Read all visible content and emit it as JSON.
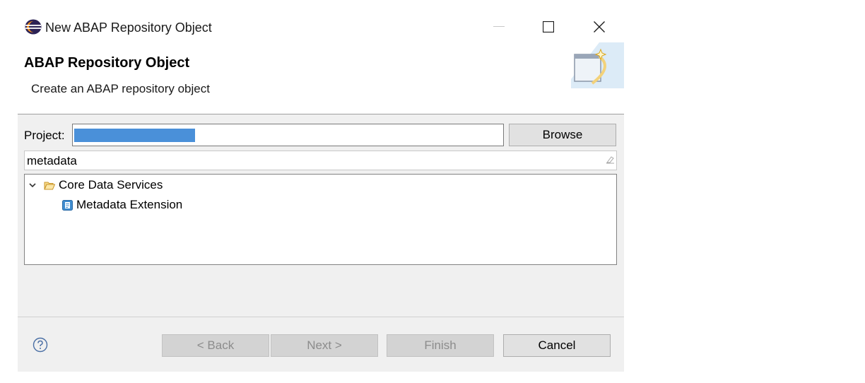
{
  "window": {
    "title": "New ABAP Repository Object",
    "app_icon": "eclipse-icon",
    "controls": {
      "minimize": "minimize-icon",
      "maximize": "maximize-icon",
      "close": "close-icon"
    }
  },
  "banner": {
    "title": "ABAP Repository Object",
    "description": "Create an ABAP repository object",
    "image": "wizard-banner-icon"
  },
  "project": {
    "label": "Project:",
    "browse_label": "Browse"
  },
  "filter": {
    "value": "metadata",
    "clear_icon": "clear-filter-icon"
  },
  "tree": {
    "items": [
      {
        "label": "Core Data Services",
        "icon": "folder-open-icon",
        "expanded": true,
        "level": 0
      },
      {
        "label": "Metadata Extension",
        "icon": "metadata-extension-icon",
        "level": 1
      }
    ]
  },
  "footer": {
    "help_icon": "help-icon",
    "back_label": "< Back",
    "next_label": "Next >",
    "finish_label": "Finish",
    "cancel_label": "Cancel"
  },
  "colors": {
    "selection": "#4a90d9",
    "dialog_bg": "#f0f0f0",
    "disabled_text": "#8c8c8c"
  }
}
